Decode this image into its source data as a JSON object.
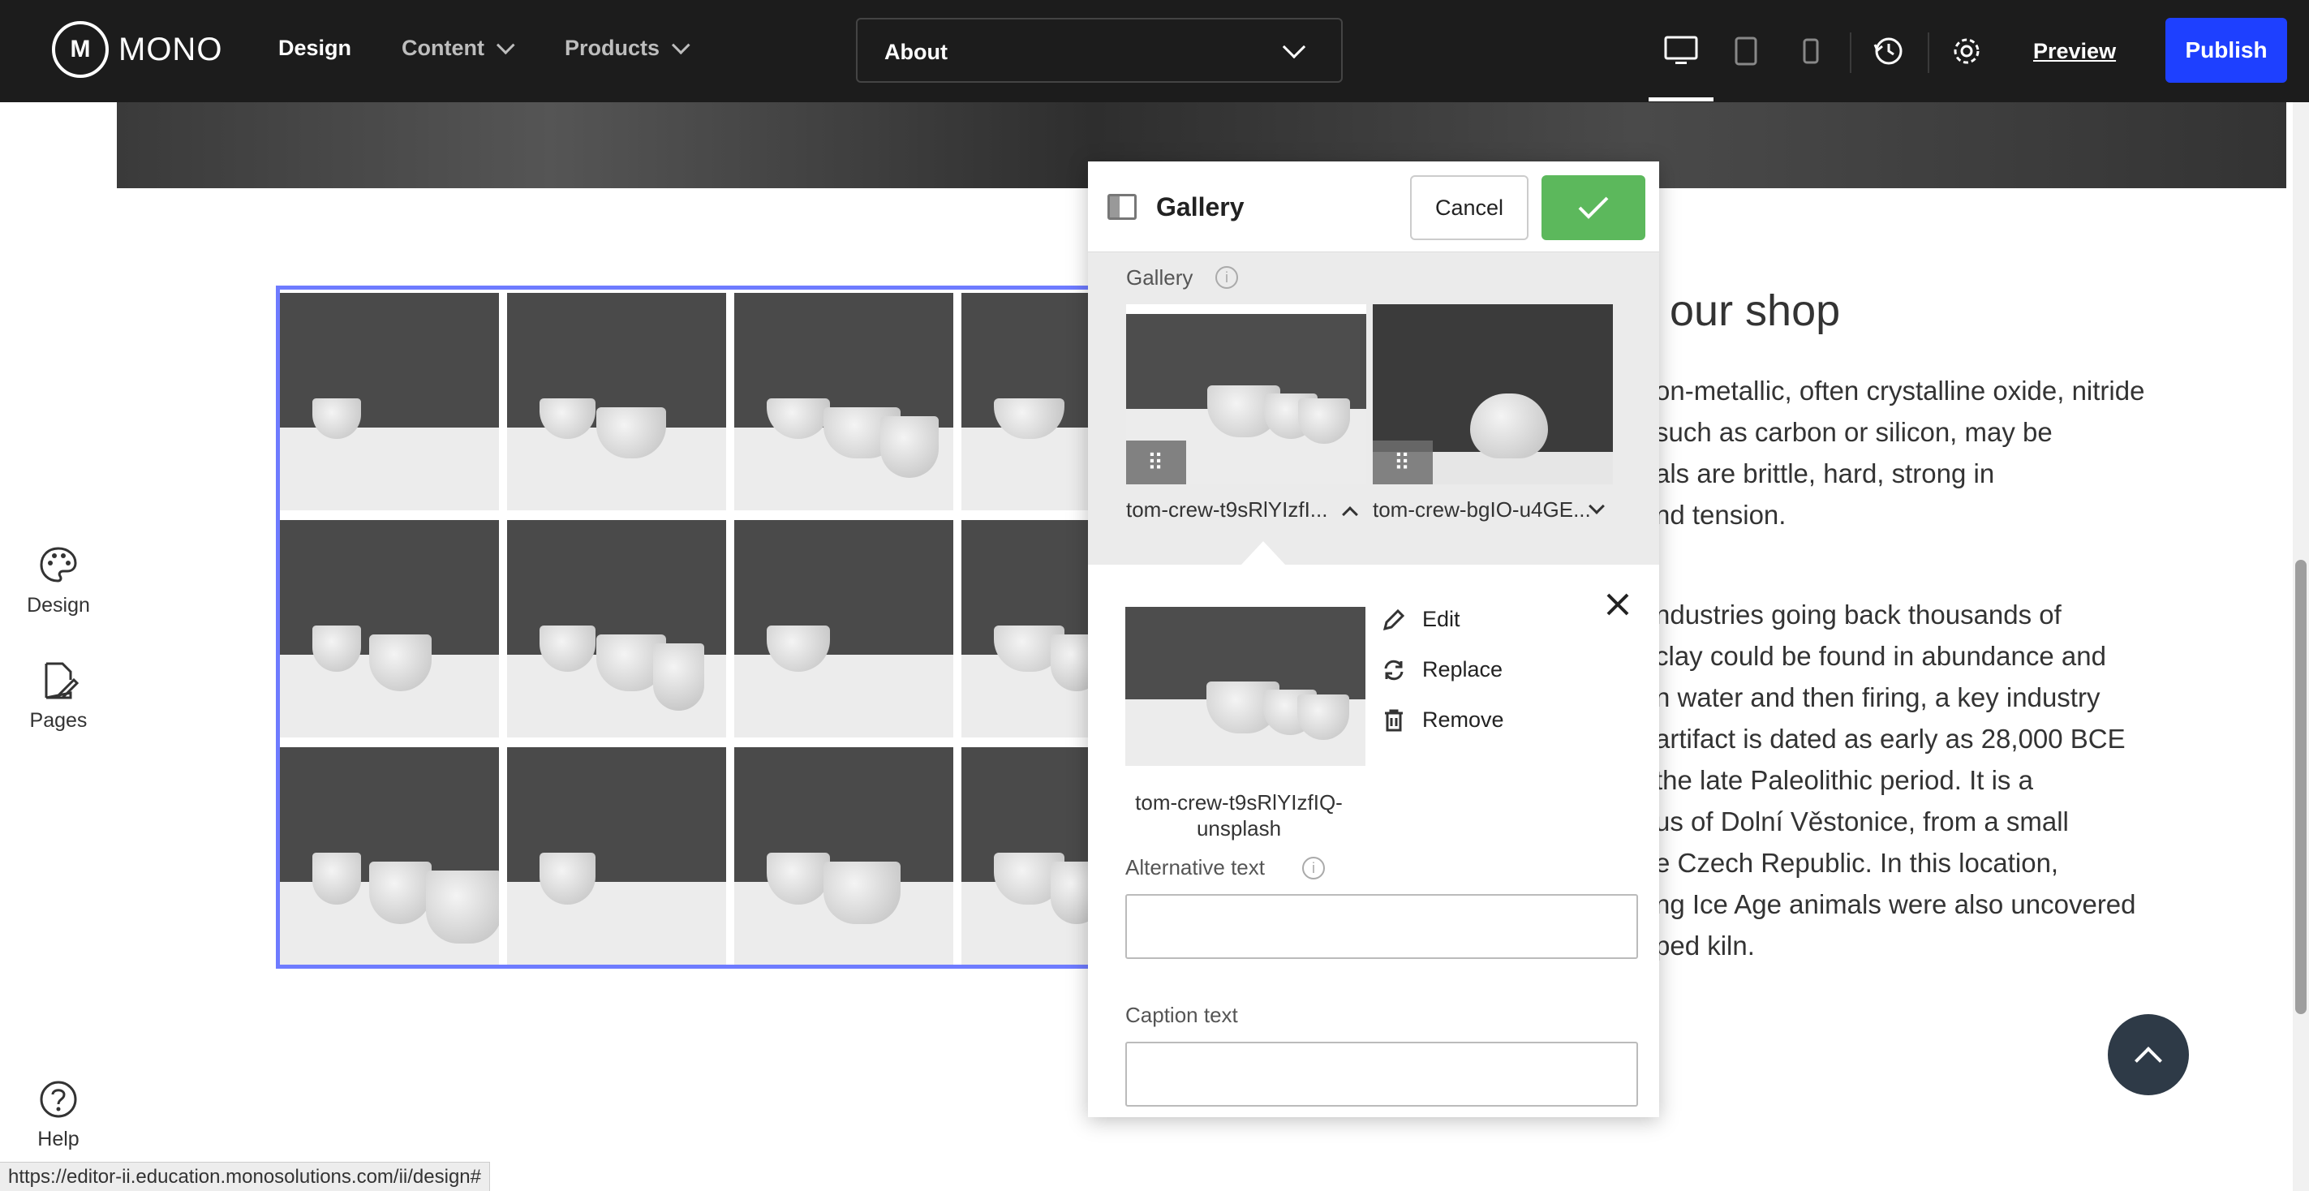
{
  "topbar": {
    "logo_text": "MONO",
    "nav": {
      "design": "Design",
      "content": "Content",
      "products": "Products"
    },
    "page_selector": "About",
    "preview": "Preview",
    "publish": "Publish"
  },
  "rail": {
    "design": "Design",
    "pages": "Pages",
    "help": "Help"
  },
  "content": {
    "heading": "our shop",
    "p1": [
      "on-metallic, often crystalline oxide, nitride",
      "such as carbon or silicon, may be",
      "als are brittle, hard, strong in",
      "nd tension."
    ],
    "p2": [
      "ndustries going back thousands of",
      "clay could be found in abundance and",
      "n water and then firing, a key industry",
      "artifact is dated as early as 28,000 BCE",
      "the late Paleolithic period. It is a",
      "us of Dolní Věstonice, from a small",
      "e Czech Republic. In this location,",
      "ng Ice Age animals were also uncovered",
      "ped kiln."
    ]
  },
  "panel": {
    "title": "Gallery",
    "cancel": "Cancel",
    "gallery_label": "Gallery",
    "items": [
      {
        "name": "tom-crew-t9sRlYIzfI..."
      },
      {
        "name": "tom-crew-bgIO-u4GE..."
      }
    ],
    "selected": {
      "caption_line1": "tom-crew-t9sRlYIzfIQ-",
      "caption_line2": "unsplash",
      "edit": "Edit",
      "replace": "Replace",
      "remove": "Remove"
    },
    "alt_label": "Alternative text",
    "alt_value": "",
    "caption_label": "Caption text",
    "caption_value": ""
  },
  "status_url": "https://editor-ii.education.monosolutions.com/ii/design#"
}
